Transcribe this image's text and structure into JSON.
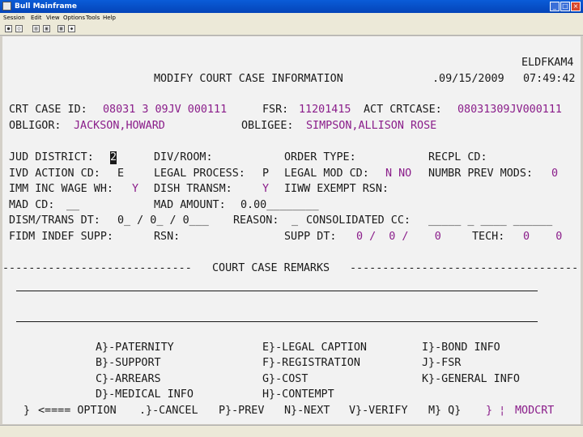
{
  "window": {
    "title": "Bull Mainframe"
  },
  "menubar": {
    "items": [
      "Session",
      "Edit",
      "View",
      "Options",
      "Tools",
      "Help"
    ]
  },
  "header": {
    "terminal_id": "ELDFKAM4",
    "screen_title": "MODIFY COURT CASE INFORMATION",
    "date": ".09/15/2009",
    "time": "07:49:42"
  },
  "case": {
    "crt_case_id_label": "CRT CASE ID:",
    "crt_case_id": "08031 3 09JV 000111",
    "fsr_label": "FSR:",
    "fsr": "11201415",
    "act_crtcase_label": "ACT CRTCASE:",
    "act_crtcase": "08031309JV000111",
    "obligor_label": "OBLIGOR:",
    "obligor": "JACKSON,HOWARD",
    "obligee_label": "OBLIGEE:",
    "obligee": "SIMPSON,ALLISON ROSE"
  },
  "fields": {
    "jud_district_label": "JUD DISTRICT:",
    "jud_district": "2",
    "div_room_label": "DIV/ROOM:",
    "order_type_label": "ORDER TYPE:",
    "recpl_cd_label": "RECPL CD:",
    "ivd_action_cd_label": "IVD ACTION CD:",
    "ivd_action_cd": "E",
    "legal_process_label": "LEGAL PROCESS:",
    "legal_process": "P",
    "legal_mod_cd_label": "LEGAL MOD CD:",
    "legal_mod_cd": "N NO",
    "numbr_prev_mods_label": "NUMBR PREV MODS:",
    "numbr_prev_mods": "0",
    "imm_inc_wage_wh_label": "IMM INC WAGE WH:",
    "imm_inc_wage_wh": "Y",
    "dish_transm_label": "DISH TRANSM:",
    "dish_transm": "Y",
    "iiww_exempt_rsn_label": "IIWW EXEMPT RSN:",
    "mad_cd_label": "MAD CD:",
    "mad_cd": "__",
    "mad_amount_label": "MAD AMOUNT:",
    "mad_amount": "0.00________",
    "dism_trans_dt_label": "DISM/TRANS DT:",
    "dism_trans_dt": "0_ / 0_ / 0___",
    "reason_label": "REASON:",
    "reason": "_",
    "consolidated_cc_label": "CONSOLIDATED CC:",
    "consolidated_cc": "_____ _ ____ ______",
    "fidm_indef_supp_label": "FIDM INDEF SUPP:",
    "rsn_label": "RSN:",
    "supp_dt_label": "SUPP DT:",
    "supp_dt": "0 /  0 /    0",
    "tech_label": "TECH:",
    "tech": "0    0"
  },
  "remarks": {
    "divider_left": "-----------------------------",
    "label": "COURT CASE REMARKS",
    "divider_right": "-----------------------------------"
  },
  "menu_options": {
    "a": "A}-PATERNITY",
    "b": "B}-SUPPORT",
    "c": "C}-ARREARS",
    "d": "D}-MEDICAL INFO",
    "e": "E}-LEGAL CAPTION",
    "f": "F}-REGISTRATION",
    "g": "G}-COST",
    "h": "H}-CONTEMPT",
    "i": "I}-BOND INFO",
    "j": "J}-FSR",
    "k": "K}-GENERAL INFO"
  },
  "footer": {
    "option_field": "}",
    "option_label": "<==== OPTION",
    "cancel": ".}-CANCEL",
    "prev": "P}-PREV",
    "next": "N}-NEXT",
    "verify": "V}-VERIFY",
    "mq": "M} Q}",
    "right_markers": "} ¦",
    "modcrt": "MODCRT"
  },
  "colors": {
    "field_value": "#8a1d8a",
    "text": "#1a1a1a",
    "screen_bg": "#f2f2f2",
    "titlebar": "#0a5cd8"
  }
}
